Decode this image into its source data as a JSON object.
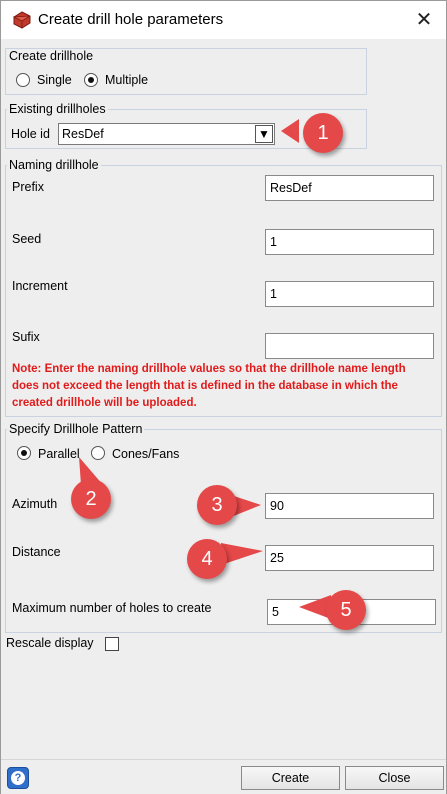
{
  "window": {
    "title": "Create drill hole parameters",
    "close_glyph": "✕"
  },
  "create_drillhole": {
    "group_label": "Create drillhole",
    "options": [
      {
        "label": "Single",
        "selected": false
      },
      {
        "label": "Multiple",
        "selected": true
      }
    ]
  },
  "existing_drillholes": {
    "group_label": "Existing drillholes",
    "hole_id_label": "Hole id",
    "hole_id_value": "ResDef",
    "dropdown_glyph": "▼"
  },
  "naming_drillhole": {
    "group_label": "Naming drillhole",
    "prefix_label": "Prefix",
    "prefix_value": "ResDef",
    "seed_label": "Seed",
    "seed_value": "1",
    "increment_label": "Increment",
    "increment_value": "1",
    "sufix_label": "Sufix",
    "sufix_value": "",
    "note": "Note: Enter the naming drillhole values so that the drillhole name length does not exceed the length that is defined in the database in which the created drillhole will be uploaded."
  },
  "drillhole_pattern": {
    "group_label": "Specify Drillhole Pattern",
    "options": [
      {
        "label": "Parallel",
        "selected": true
      },
      {
        "label": "Cones/Fans",
        "selected": false
      }
    ],
    "azimuth_label": "Azimuth",
    "azimuth_value": "90",
    "distance_label": "Distance",
    "distance_value": "25",
    "max_holes_label": "Maximum number of holes to create",
    "max_holes_value": "5"
  },
  "rescale_display": {
    "label": "Rescale display",
    "checked": false
  },
  "callouts": [
    "1",
    "2",
    "3",
    "4",
    "5"
  ],
  "buttons": {
    "help_glyph": "?",
    "create": "Create",
    "close": "Close"
  },
  "colors": {
    "callout": "#e54848",
    "note": "#e11b1b",
    "help": "#2f6fca"
  }
}
